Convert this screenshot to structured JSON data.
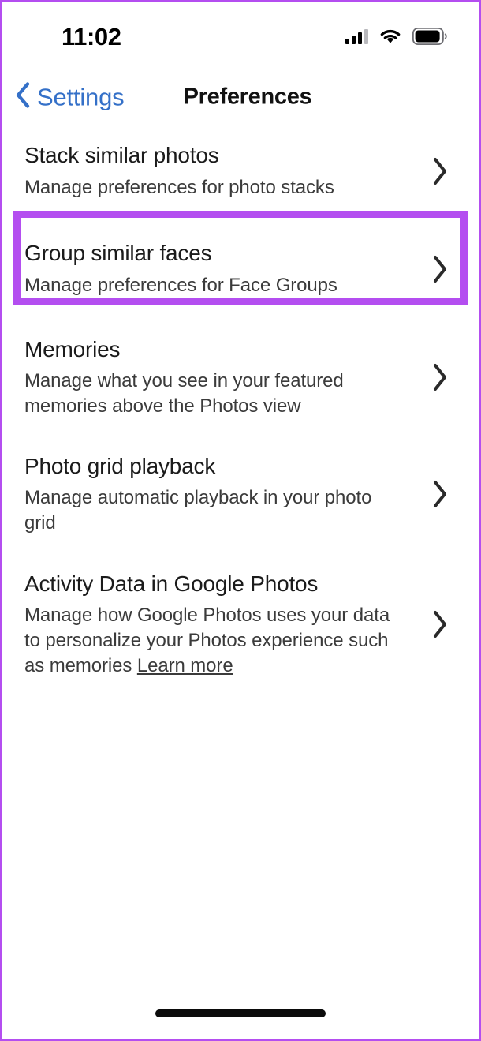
{
  "status_bar": {
    "time": "11:02",
    "cellular_icon": "cellular-signal-icon",
    "wifi_icon": "wifi-icon",
    "battery_icon": "battery-icon"
  },
  "nav": {
    "back_icon": "chevron-left-icon",
    "back_label": "Settings",
    "title": "Preferences"
  },
  "list": {
    "rows": [
      {
        "title": "Stack similar photos",
        "subtitle": "Manage preferences for photo stacks",
        "chevron": "chevron-right-icon"
      },
      {
        "title": "Group similar faces",
        "subtitle": "Manage preferences for Face Groups",
        "chevron": "chevron-right-icon"
      },
      {
        "title": "Memories",
        "subtitle": "Manage what you see in your featured memories above the Photos view",
        "chevron": "chevron-right-icon"
      },
      {
        "title": "Photo grid playback",
        "subtitle": "Manage automatic playback in your photo grid",
        "chevron": "chevron-right-icon"
      },
      {
        "title": "Activity Data in Google Photos",
        "subtitle": "Manage how Google Photos uses your data to personalize your Photos experience such as memories ",
        "link_label": "Learn more",
        "chevron": "chevron-right-icon"
      }
    ]
  },
  "annotation": {
    "highlight_color": "#b44ef0",
    "target": "Group similar faces"
  },
  "colors": {
    "accent_blue": "#3470c8",
    "title_text": "#1b1b1b",
    "subtitle_text": "#3b3b3b",
    "highlight_purple": "#b44ef0",
    "background": "#ffffff"
  },
  "home_indicator": "home-indicator"
}
